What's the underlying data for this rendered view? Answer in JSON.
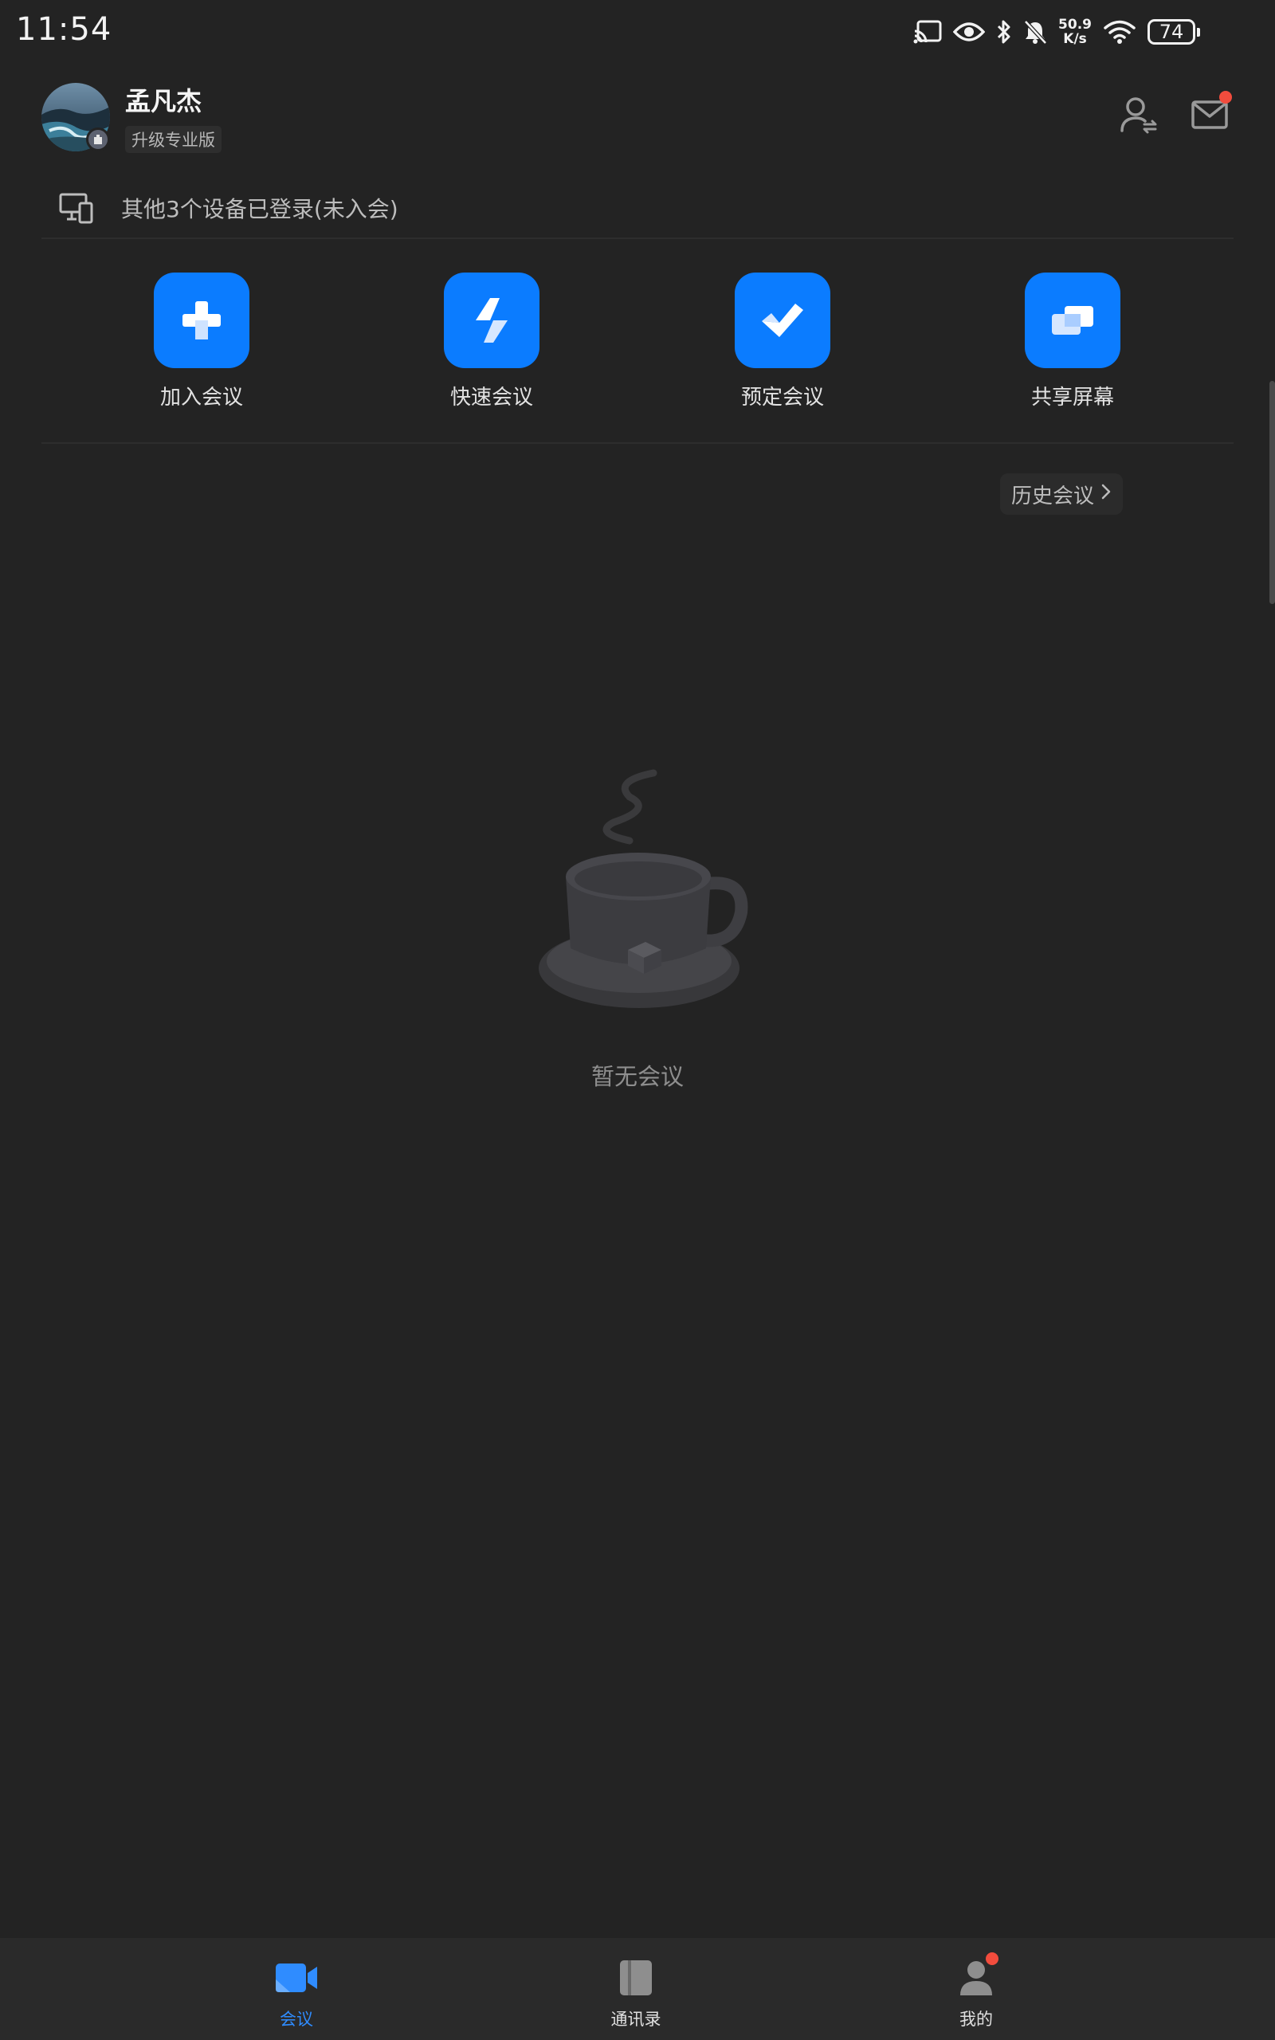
{
  "status_bar": {
    "time": "11:54",
    "net_speed_value": "50.9",
    "net_speed_unit": "K/s",
    "battery": "74",
    "icons": [
      "cast-icon",
      "eye-icon",
      "bluetooth-icon",
      "bell-off-icon",
      "wifi-icon",
      "battery-icon"
    ]
  },
  "header": {
    "user_name": "孟凡杰",
    "upgrade_label": "升级专业版"
  },
  "devices": {
    "text": "其他3个设备已登录(未入会)"
  },
  "actions": [
    {
      "label": "加入会议",
      "icon": "plus-icon"
    },
    {
      "label": "快速会议",
      "icon": "lightning-icon"
    },
    {
      "label": "预定会议",
      "icon": "check-icon"
    },
    {
      "label": "共享屏幕",
      "icon": "share-screen-icon"
    }
  ],
  "history": {
    "label": "历史会议"
  },
  "empty_state": {
    "text": "暂无会议"
  },
  "bottom_nav": [
    {
      "label": "会议",
      "icon": "video-icon",
      "active": true
    },
    {
      "label": "通讯录",
      "icon": "contacts-book-icon",
      "active": false
    },
    {
      "label": "我的",
      "icon": "person-icon",
      "active": false
    }
  ],
  "colors": {
    "background": "#232323",
    "accent": "#0b7cff",
    "active_nav": "#2f8cff",
    "notification_dot": "#f24c3d"
  }
}
